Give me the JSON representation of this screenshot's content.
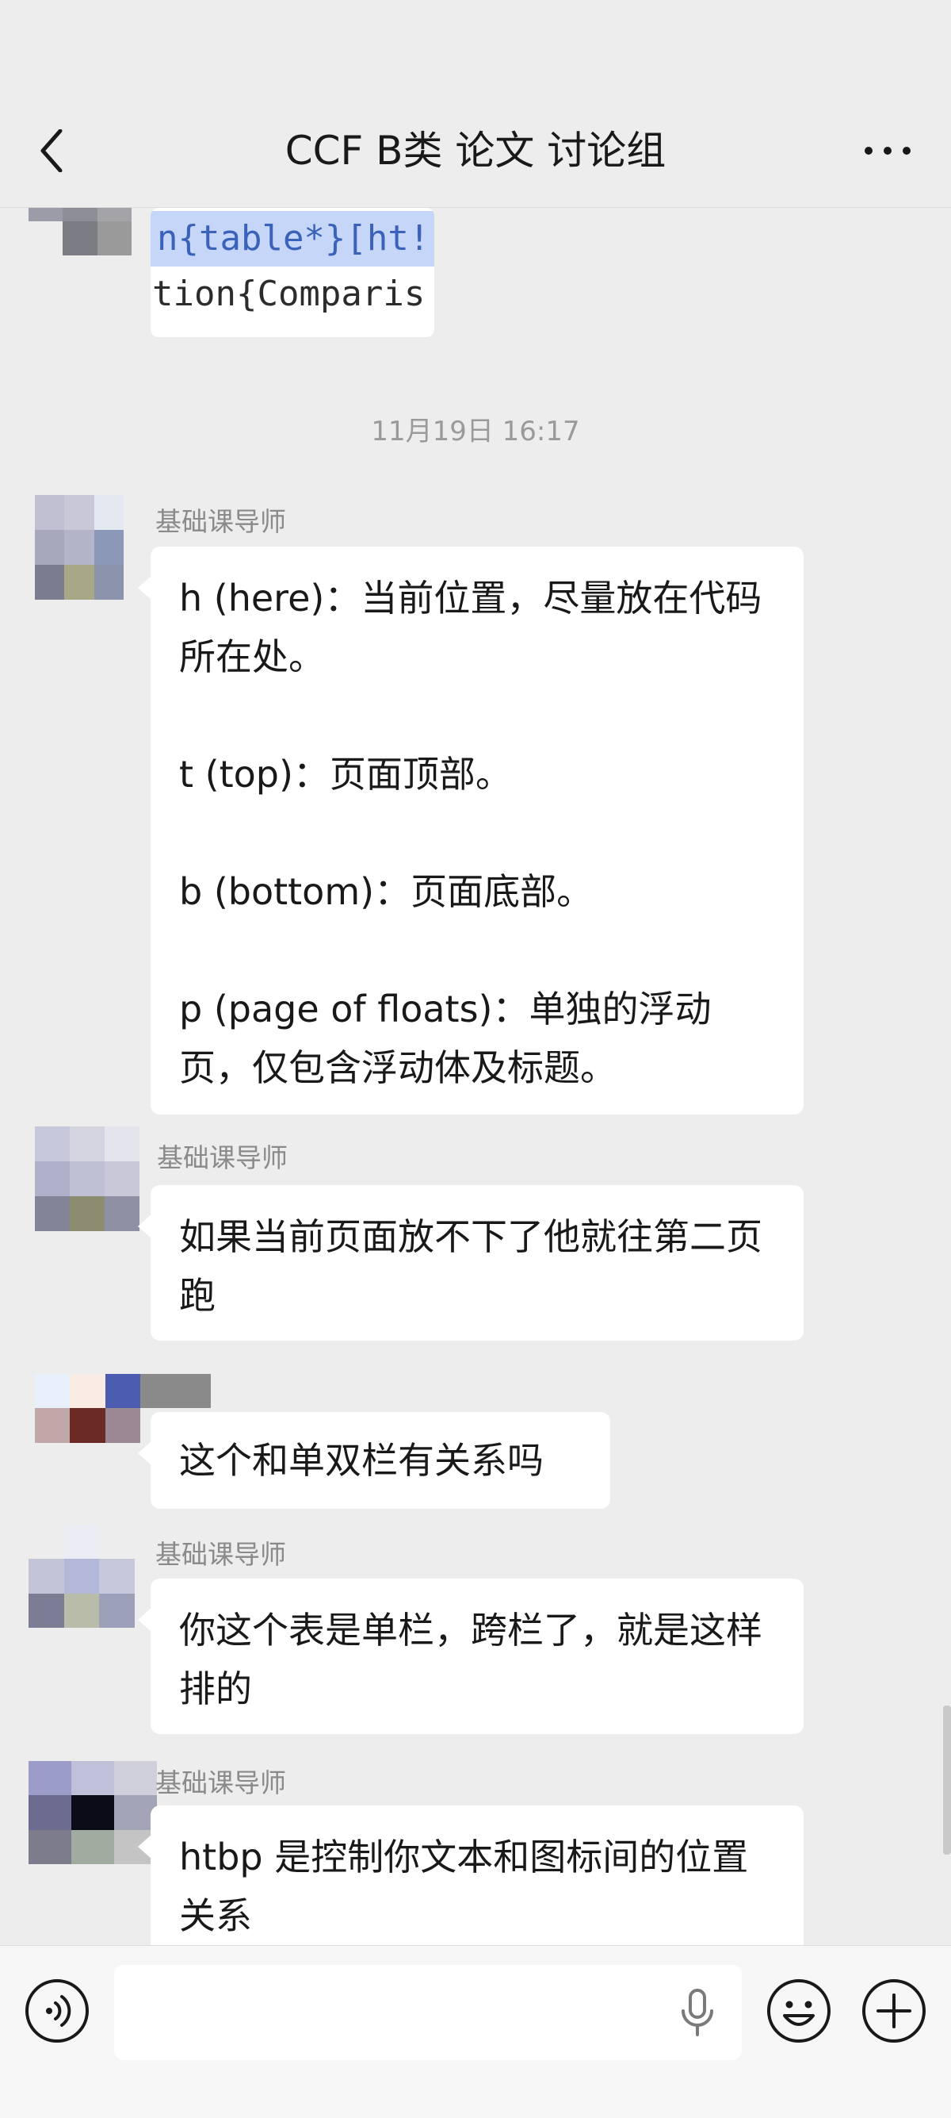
{
  "header": {
    "title": "CCF B类 论文 讨论组",
    "back_icon": "chevron-left-icon",
    "more_icon": "more-dots-icon"
  },
  "chat": {
    "code_snippet": {
      "line1": "n{table*}[ht!",
      "line2": "tion{Comparis"
    },
    "timestamp": "11月19日 16:17",
    "messages": [
      {
        "sender": "基础课导师",
        "text": "h (here)：当前位置，尽量放在代码所在处。\n\nt (top)：页面顶部。\n\nb (bottom)：页面底部。\n\np (page of floats)：单独的浮动页，仅包含浮动体及标题。"
      },
      {
        "sender": "基础课导师",
        "text": "如果当前页面放不下了他就往第二页跑"
      },
      {
        "sender": "",
        "text": "这个和单双栏有关系吗"
      },
      {
        "sender": "基础课导师",
        "text": "你这个表是单栏，跨栏了，就是这样排的"
      },
      {
        "sender": "基础课导师",
        "text": "htbp 是控制你文本和图标间的位置关系"
      }
    ]
  },
  "input_bar": {
    "placeholder": "",
    "voice_icon": "voice-icon",
    "mic_icon": "microphone-icon",
    "emoji_icon": "emoji-icon",
    "plus_icon": "plus-icon"
  },
  "colors": {
    "background": "#ededed",
    "bubble": "#ffffff",
    "text": "#191919",
    "sender": "#8a8a8a"
  }
}
